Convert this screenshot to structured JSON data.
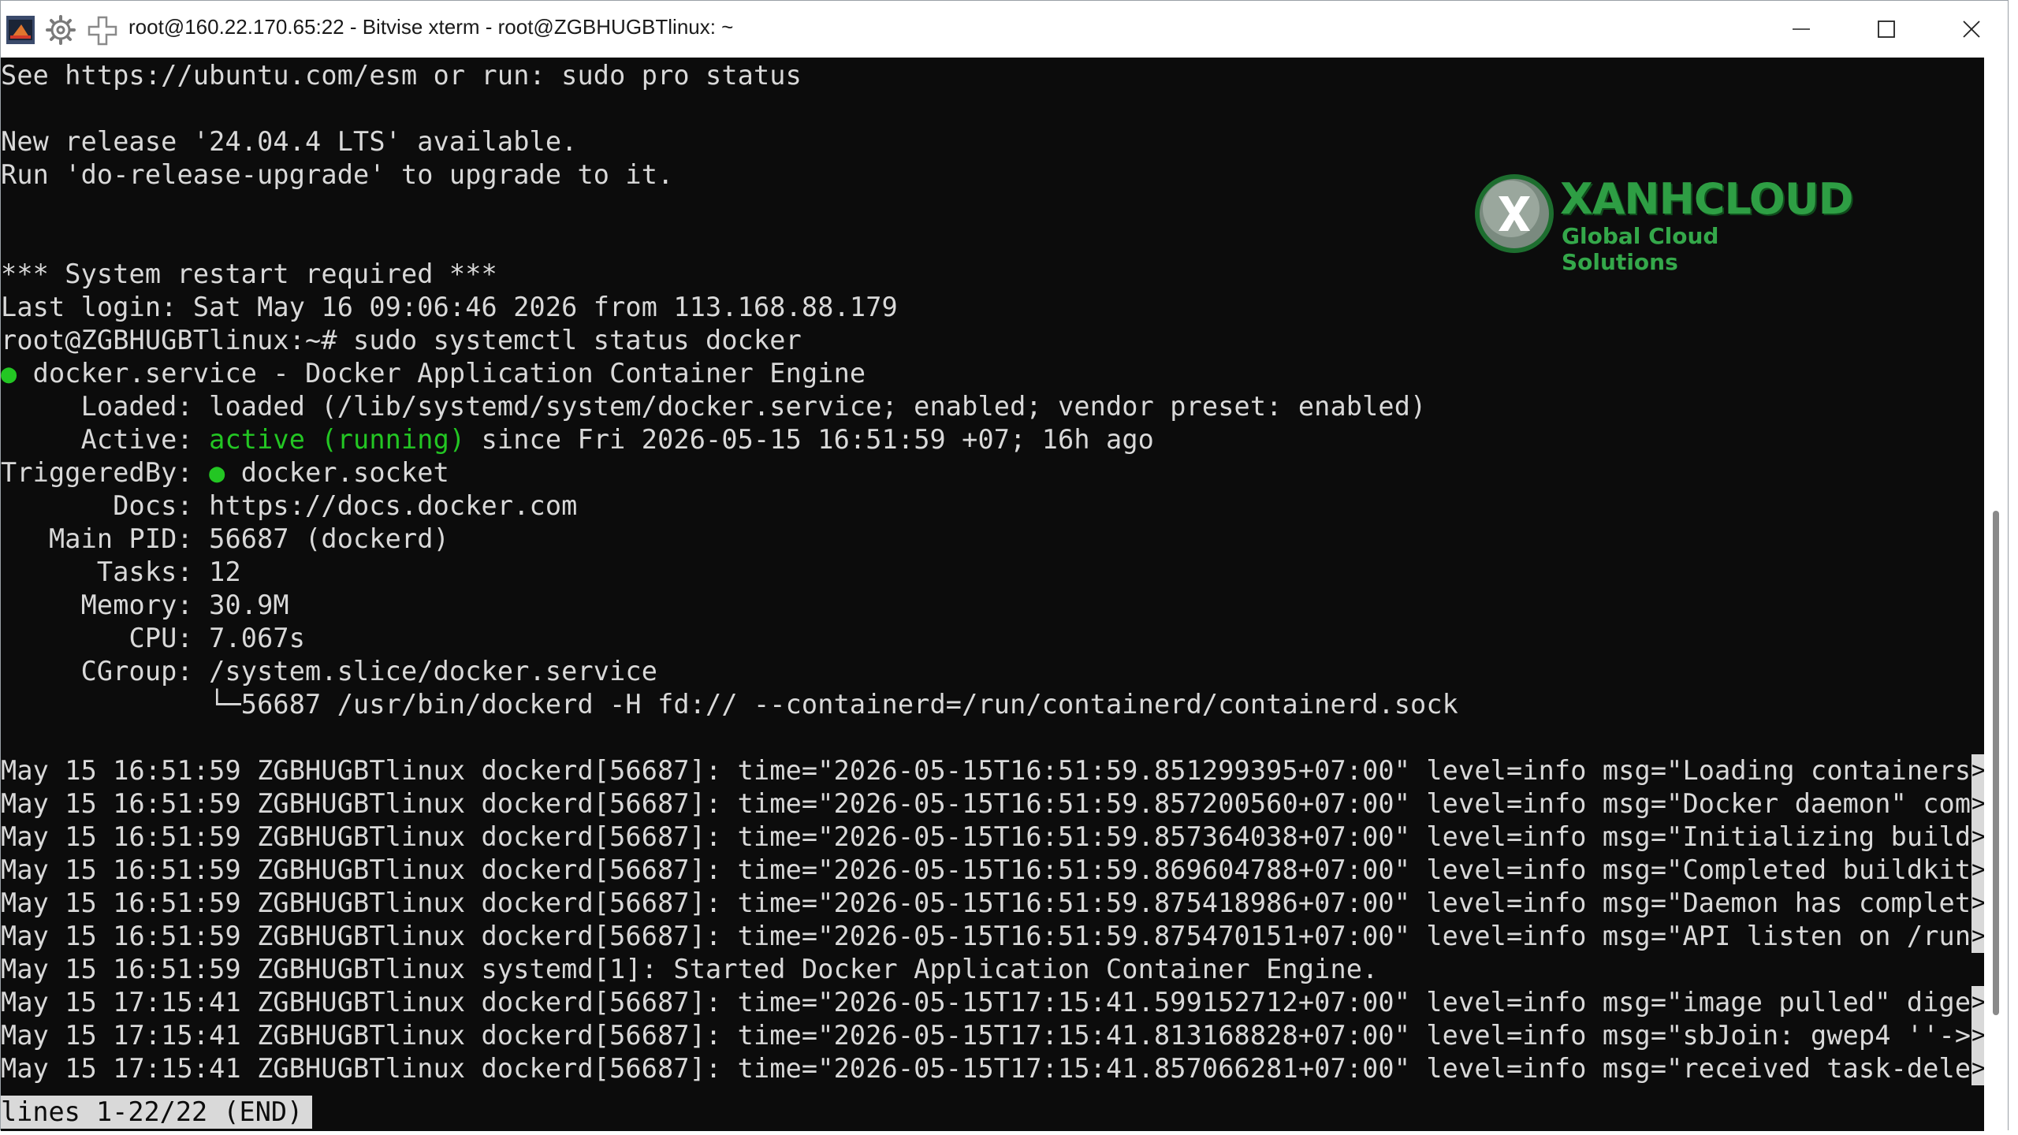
{
  "window": {
    "title": "root@160.22.170.65:22 - Bitvise xterm - root@ZGBHUGBTlinux: ~"
  },
  "logo": {
    "name": "XANHCLOUD",
    "tagline": "Global Cloud Solutions",
    "mark": "X"
  },
  "colors": {
    "terminal_bg": "#0c0c0c",
    "terminal_fg": "#d9d9d9",
    "active_green": "#23c623",
    "logo_green": "#2e9e44"
  },
  "terminal": {
    "l1": "See https://ubuntu.com/esm or run: sudo pro status",
    "l2": "New release '24.04.4 LTS' available.",
    "l3": "Run 'do-release-upgrade' to upgrade to it.",
    "l4": "*** System restart required ***",
    "l5": "Last login: Sat May 16 09:06:46 2026 from 113.168.88.179",
    "l6": "root@ZGBHUGBTlinux:~# sudo systemctl status docker",
    "l7_dot": "●",
    "l7": " docker.service - Docker Application Container Engine",
    "l8": "     Loaded: loaded (/lib/systemd/system/docker.service; enabled; vendor preset: enabled)",
    "l9_a": "     Active: ",
    "l9_b": "active (running)",
    "l9_c": " since Fri 2026-05-15 16:51:59 +07; 16h ago",
    "l10_a": "TriggeredBy: ",
    "l10_dot": "●",
    "l10_b": " docker.socket",
    "l11": "       Docs: https://docs.docker.com",
    "l12": "   Main PID: 56687 (dockerd)",
    "l13": "      Tasks: 12",
    "l14": "     Memory: 30.9M",
    "l15": "        CPU: 7.067s",
    "l16": "     CGroup: /system.slice/docker.service",
    "l17": "             └─56687 /usr/bin/dockerd -H fd:// --containerd=/run/containerd/containerd.sock",
    "log": [
      "May 15 16:51:59 ZGBHUGBTlinux dockerd[56687]: time=\"2026-05-15T16:51:59.851299395+07:00\" level=info msg=\"Loading containers",
      "May 15 16:51:59 ZGBHUGBTlinux dockerd[56687]: time=\"2026-05-15T16:51:59.857200560+07:00\" level=info msg=\"Docker daemon\" com",
      "May 15 16:51:59 ZGBHUGBTlinux dockerd[56687]: time=\"2026-05-15T16:51:59.857364038+07:00\" level=info msg=\"Initializing build",
      "May 15 16:51:59 ZGBHUGBTlinux dockerd[56687]: time=\"2026-05-15T16:51:59.869604788+07:00\" level=info msg=\"Completed buildkit",
      "May 15 16:51:59 ZGBHUGBTlinux dockerd[56687]: time=\"2026-05-15T16:51:59.875418986+07:00\" level=info msg=\"Daemon has complet",
      "May 15 16:51:59 ZGBHUGBTlinux dockerd[56687]: time=\"2026-05-15T16:51:59.875470151+07:00\" level=info msg=\"API listen on /run",
      "May 15 16:51:59 ZGBHUGBTlinux systemd[1]: Started Docker Application Container Engine.",
      "May 15 17:15:41 ZGBHUGBTlinux dockerd[56687]: time=\"2026-05-15T17:15:41.599152712+07:00\" level=info msg=\"image pulled\" dige",
      "May 15 17:15:41 ZGBHUGBTlinux dockerd[56687]: time=\"2026-05-15T17:15:41.813168828+07:00\" level=info msg=\"sbJoin: gwep4 ''->",
      "May 15 17:15:41 ZGBHUGBTlinux dockerd[56687]: time=\"2026-05-15T17:15:41.857066281+07:00\" level=info msg=\"received task-dele"
    ],
    "trunc_marker": ">",
    "pager_status": "lines 1-22/22 (END)"
  }
}
